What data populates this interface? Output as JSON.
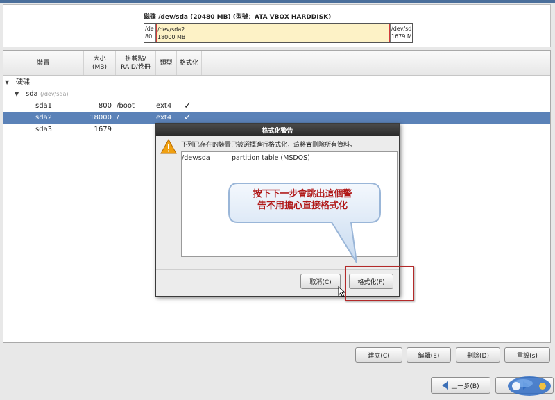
{
  "disk": {
    "title": "磁碟 /dev/sda (20480 MB) (型號：ATA VBOX HARDDISK)",
    "partitions": [
      {
        "line1": "/de",
        "line2": "80"
      },
      {
        "line1": "/dev/sda2",
        "line2": "18000 MB"
      },
      {
        "line1": "/dev/sd",
        "line2": "1679 M"
      }
    ]
  },
  "tree": {
    "columns": {
      "device": "裝置",
      "size_line1": "大小",
      "size_line2": "(MB)",
      "mount_line1": "掛載點/",
      "mount_line2": "RAID/卷冊",
      "type": "類型",
      "format": "格式化"
    },
    "rows": [
      {
        "name": "硬碟",
        "size": "",
        "mount": "",
        "type": "",
        "format": ""
      },
      {
        "name": "sda",
        "sub": "(/dev/sda)",
        "size": "",
        "mount": "",
        "type": "",
        "format": ""
      },
      {
        "name": "sda1",
        "size": "800",
        "mount": "/boot",
        "type": "ext4",
        "format": "✓"
      },
      {
        "name": "sda2",
        "size": "18000",
        "mount": "/",
        "type": "ext4",
        "format": "✓"
      },
      {
        "name": "sda3",
        "size": "1679",
        "mount": "",
        "type": "",
        "format": ""
      }
    ]
  },
  "buttons": {
    "create": "建立(C)",
    "edit": "編輯(E)",
    "delete": "刪除(D)",
    "reset": "重設(s)",
    "back": "上一步(B)",
    "next": ""
  },
  "dialog": {
    "title": "格式化警告",
    "message": "下列已存在的裝置已被選擇進行格式化，這將會刪除所有資料。",
    "items": [
      {
        "device": "/dev/sda",
        "desc": "partition table (MSDOS)"
      }
    ],
    "cancel": "取消(C)",
    "format": "格式化(F)"
  },
  "annotation": {
    "line1": "按下下一步會跳出這個警",
    "line2": "告不用擔心直接格式化"
  },
  "colors": {
    "selection": "#5b82b8",
    "highlight": "#b32a2a",
    "callout_text": "#b01717",
    "partition_fill": "#fdf2c6"
  },
  "icons": {
    "warning": "warning-triangle-icon",
    "back": "arrow-left-icon",
    "next": "arrow-right-icon"
  }
}
